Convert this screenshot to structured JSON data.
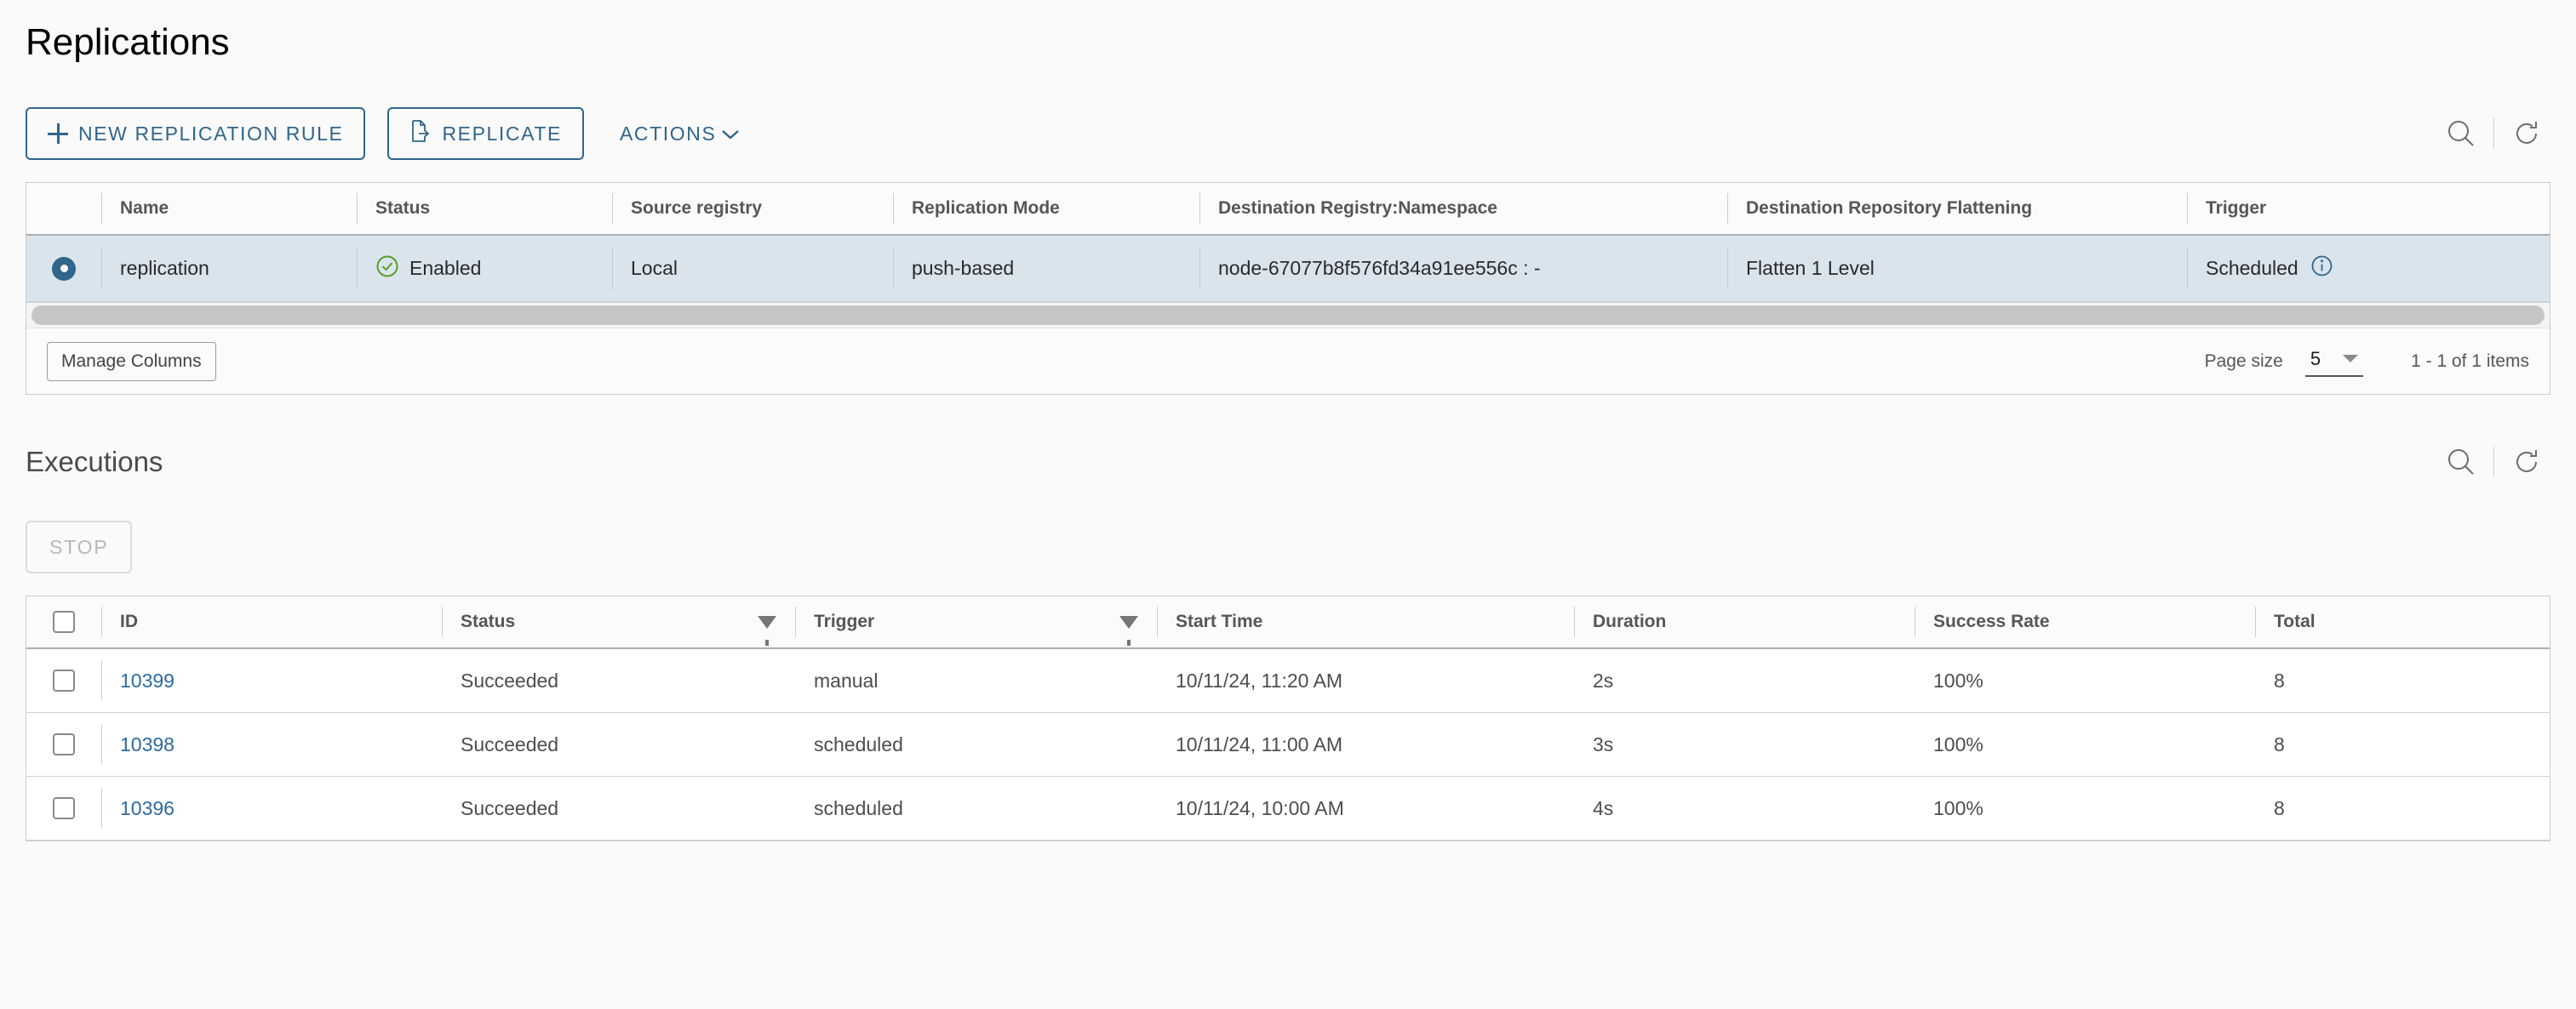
{
  "page": {
    "title": "Replications"
  },
  "toolbar": {
    "new_rule_label": "NEW REPLICATION RULE",
    "replicate_label": "REPLICATE",
    "actions_label": "ACTIONS",
    "search_icon": "search-icon",
    "refresh_icon": "refresh-icon"
  },
  "replication_table": {
    "columns": [
      "Name",
      "Status",
      "Source registry",
      "Replication Mode",
      "Destination Registry:Namespace",
      "Destination Repository Flattening",
      "Trigger"
    ],
    "rows": [
      {
        "selected": true,
        "name": "replication",
        "status": "Enabled",
        "status_icon": "check-circle-icon",
        "source_registry": "Local",
        "replication_mode": "push-based",
        "destination": "node-67077b8f576fd34a91ee556c : -",
        "flattening": "Flatten 1 Level",
        "trigger": "Scheduled",
        "trigger_icon": "info-circle-icon"
      }
    ],
    "footer": {
      "manage_columns_label": "Manage Columns",
      "page_size_label": "Page size",
      "page_size_value": "5",
      "items_range": "1 - 1 of 1 items"
    }
  },
  "executions": {
    "title": "Executions",
    "stop_label": "STOP",
    "search_icon": "search-icon",
    "refresh_icon": "refresh-icon",
    "columns": [
      "ID",
      "Status",
      "Trigger",
      "Start Time",
      "Duration",
      "Success Rate",
      "Total"
    ],
    "rows": [
      {
        "id": "10399",
        "status": "Succeeded",
        "trigger": "manual",
        "start_time": "10/11/24, 11:20 AM",
        "duration": "2s",
        "success_rate": "100%",
        "total": "8"
      },
      {
        "id": "10398",
        "status": "Succeeded",
        "trigger": "scheduled",
        "start_time": "10/11/24, 11:00 AM",
        "duration": "3s",
        "success_rate": "100%",
        "total": "8"
      },
      {
        "id": "10396",
        "status": "Succeeded",
        "trigger": "scheduled",
        "start_time": "10/11/24, 10:00 AM",
        "duration": "4s",
        "success_rate": "100%",
        "total": "8"
      }
    ]
  },
  "colors": {
    "accent": "#30658c",
    "link": "#2d6a9f",
    "success": "#5b9d24",
    "selected_row": "#d9e4ed"
  }
}
